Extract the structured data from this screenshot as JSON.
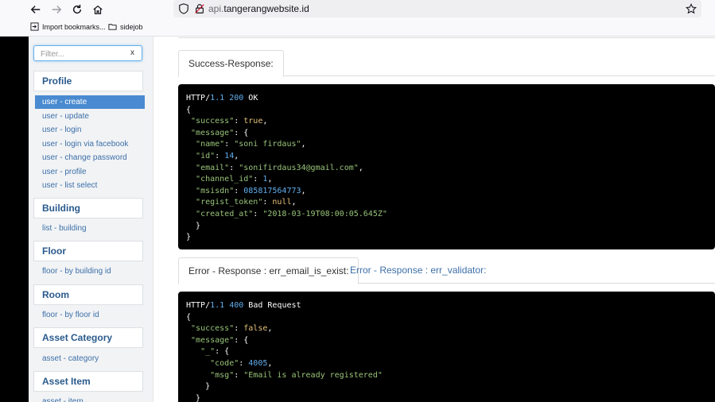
{
  "browser": {
    "url_domain_dim": "api.",
    "url_domain": "tangerangwebsite.id",
    "bookmarks": [
      {
        "label": "Import bookmarks..."
      },
      {
        "label": "sidejob"
      }
    ]
  },
  "sidebar": {
    "filter_placeholder": "Filter...",
    "filter_clear": "x",
    "groups": [
      {
        "title": "Profile",
        "items": [
          "user - create",
          "user - update",
          "user - login",
          "user - login via facebook",
          "user - change password",
          "user - profile",
          "user - list select"
        ]
      },
      {
        "title": "Building",
        "items": [
          "list - building"
        ]
      },
      {
        "title": "Floor",
        "items": [
          "floor - by building id"
        ]
      },
      {
        "title": "Room",
        "items": [
          "floor - by floor id"
        ]
      },
      {
        "title": "Asset Category",
        "items": [
          "asset - category"
        ]
      },
      {
        "title": "Asset Item",
        "items": [
          "asset - item"
        ]
      }
    ]
  },
  "main": {
    "success_tab": "Success-Response:",
    "success_code": {
      "status_proto": "HTTP/",
      "status_ver": "1.1",
      "status_code": "200",
      "status_text": "OK",
      "success_key": "\"success\"",
      "success_val": "true",
      "message_key": "\"message\"",
      "fields": [
        {
          "key": "\"name\"",
          "value": "\"soni firdaus\"",
          "kind": "string"
        },
        {
          "key": "\"id\"",
          "value": "14",
          "kind": "number"
        },
        {
          "key": "\"email\"",
          "value": "\"sonifirdaus34@gmail.com\"",
          "kind": "string"
        },
        {
          "key": "\"channel_id\"",
          "value": "1",
          "kind": "number"
        },
        {
          "key": "\"msisdn\"",
          "value": "085817564773",
          "kind": "number"
        },
        {
          "key": "\"regist_token\"",
          "value": "null",
          "kind": "keyword"
        },
        {
          "key": "\"created_at\"",
          "value": "\"2018-03-19T08:00:05.645Z\"",
          "kind": "string"
        }
      ]
    },
    "error_tabs": [
      "Error - Response : err_email_is_exist:",
      "Error - Response : err_validator:"
    ],
    "error_code": {
      "status_proto": "HTTP/",
      "status_ver": "1.1",
      "status_code": "400",
      "status_text": "Bad Request",
      "success_key": "\"success\"",
      "success_val": "false",
      "message_key": "\"message\"",
      "under_key": "\"_\"",
      "code_key": "\"code\"",
      "code_val": "4005",
      "msg_key": "\"msg\"",
      "msg_val": "\"Email is already registered\""
    }
  }
}
